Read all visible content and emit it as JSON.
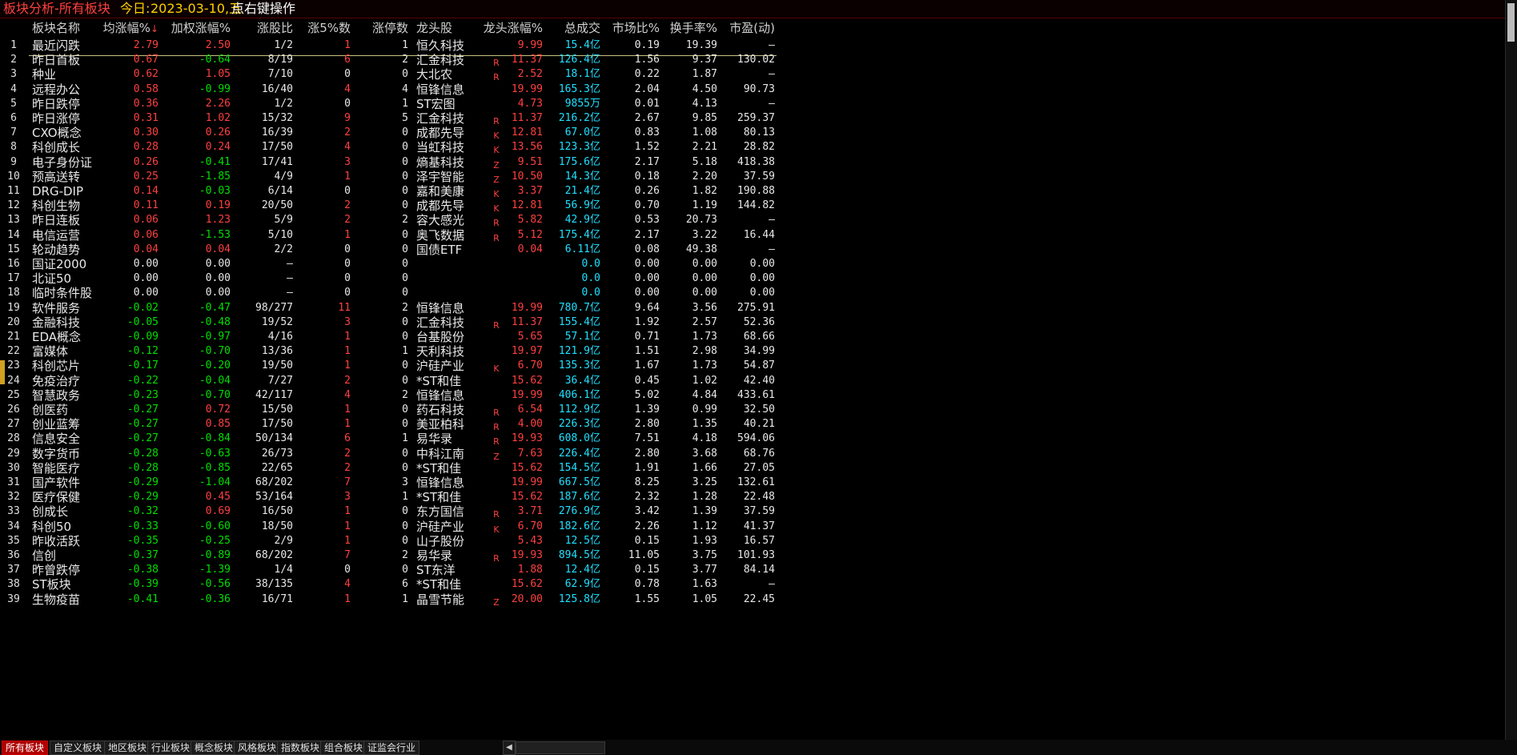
{
  "titlebar": {
    "title": "板块分析-所有板块",
    "date_label": "今日:",
    "date": "2023-03-10,五",
    "hint": "点右键操作"
  },
  "columns": {
    "name": "板块名称",
    "chg": "均涨幅%",
    "sort_indicator": "↓",
    "wchg": "加权涨幅%",
    "ratio": "涨股比",
    "up5": "涨5%数",
    "limit": "涨停数",
    "leader": "龙头股",
    "leader_chg": "龙头涨幅%",
    "amount": "总成交",
    "market": "市场比%",
    "turnover": "换手率%",
    "pe": "市盈(动)"
  },
  "colors": {
    "up": "#ff4040",
    "down": "#00e000",
    "amount": "#20e0ff",
    "accent": "#b00000"
  },
  "rows": [
    {
      "idx": "1",
      "name": "最近闪跌",
      "chg": "2.79",
      "wchg": "2.50",
      "ratio": "1/2",
      "up5": "1",
      "limit": "1",
      "leader": "恒久科技",
      "flag": "",
      "lchg": "9.99",
      "amt": "15.4亿",
      "mkt": "0.19",
      "turn": "19.39",
      "pe": "—"
    },
    {
      "idx": "2",
      "name": "昨日首板",
      "chg": "0.67",
      "wchg": "-0.64",
      "ratio": "8/19",
      "up5": "6",
      "limit": "2",
      "leader": "汇金科技",
      "flag": "R",
      "lchg": "11.37",
      "amt": "126.4亿",
      "mkt": "1.56",
      "turn": "9.37",
      "pe": "130.02"
    },
    {
      "idx": "3",
      "name": "种业",
      "chg": "0.62",
      "wchg": "1.05",
      "ratio": "7/10",
      "up5": "0",
      "limit": "0",
      "leader": "大北农",
      "flag": "R",
      "lchg": "2.52",
      "amt": "18.1亿",
      "mkt": "0.22",
      "turn": "1.87",
      "pe": "—"
    },
    {
      "idx": "4",
      "name": "远程办公",
      "chg": "0.58",
      "wchg": "-0.99",
      "ratio": "16/40",
      "up5": "4",
      "limit": "4",
      "leader": "恒锋信息",
      "flag": "",
      "lchg": "19.99",
      "amt": "165.3亿",
      "mkt": "2.04",
      "turn": "4.50",
      "pe": "90.73"
    },
    {
      "idx": "5",
      "name": "昨日跌停",
      "chg": "0.36",
      "wchg": "2.26",
      "ratio": "1/2",
      "up5": "0",
      "limit": "1",
      "leader": "ST宏图",
      "flag": "",
      "lchg": "4.73",
      "amt": "9855万",
      "mkt": "0.01",
      "turn": "4.13",
      "pe": "—"
    },
    {
      "idx": "6",
      "name": "昨日涨停",
      "chg": "0.31",
      "wchg": "1.02",
      "ratio": "15/32",
      "up5": "9",
      "limit": "5",
      "leader": "汇金科技",
      "flag": "R",
      "lchg": "11.37",
      "amt": "216.2亿",
      "mkt": "2.67",
      "turn": "9.85",
      "pe": "259.37"
    },
    {
      "idx": "7",
      "name": "CXO概念",
      "chg": "0.30",
      "wchg": "0.26",
      "ratio": "16/39",
      "up5": "2",
      "limit": "0",
      "leader": "成都先导",
      "flag": "K",
      "lchg": "12.81",
      "amt": "67.0亿",
      "mkt": "0.83",
      "turn": "1.08",
      "pe": "80.13"
    },
    {
      "idx": "8",
      "name": "科创成长",
      "chg": "0.28",
      "wchg": "0.24",
      "ratio": "17/50",
      "up5": "4",
      "limit": "0",
      "leader": "当虹科技",
      "flag": "K",
      "lchg": "13.56",
      "amt": "123.3亿",
      "mkt": "1.52",
      "turn": "2.21",
      "pe": "28.82"
    },
    {
      "idx": "9",
      "name": "电子身份证",
      "chg": "0.26",
      "wchg": "-0.41",
      "ratio": "17/41",
      "up5": "3",
      "limit": "0",
      "leader": "熵基科技",
      "flag": "Z",
      "lchg": "9.51",
      "amt": "175.6亿",
      "mkt": "2.17",
      "turn": "5.18",
      "pe": "418.38"
    },
    {
      "idx": "10",
      "name": "预高送转",
      "chg": "0.25",
      "wchg": "-1.85",
      "ratio": "4/9",
      "up5": "1",
      "limit": "0",
      "leader": "泽宇智能",
      "flag": "Z",
      "lchg": "10.50",
      "amt": "14.3亿",
      "mkt": "0.18",
      "turn": "2.20",
      "pe": "37.59"
    },
    {
      "idx": "11",
      "name": "DRG-DIP",
      "chg": "0.14",
      "wchg": "-0.03",
      "ratio": "6/14",
      "up5": "0",
      "limit": "0",
      "leader": "嘉和美康",
      "flag": "K",
      "lchg": "3.37",
      "amt": "21.4亿",
      "mkt": "0.26",
      "turn": "1.82",
      "pe": "190.88"
    },
    {
      "idx": "12",
      "name": "科创生物",
      "chg": "0.11",
      "wchg": "0.19",
      "ratio": "20/50",
      "up5": "2",
      "limit": "0",
      "leader": "成都先导",
      "flag": "K",
      "lchg": "12.81",
      "amt": "56.9亿",
      "mkt": "0.70",
      "turn": "1.19",
      "pe": "144.82"
    },
    {
      "idx": "13",
      "name": "昨日连板",
      "chg": "0.06",
      "wchg": "1.23",
      "ratio": "5/9",
      "up5": "2",
      "limit": "2",
      "leader": "容大感光",
      "flag": "R",
      "lchg": "5.82",
      "amt": "42.9亿",
      "mkt": "0.53",
      "turn": "20.73",
      "pe": "—"
    },
    {
      "idx": "14",
      "name": "电信运营",
      "chg": "0.06",
      "wchg": "-1.53",
      "ratio": "5/10",
      "up5": "1",
      "limit": "0",
      "leader": "奥飞数据",
      "flag": "R",
      "lchg": "5.12",
      "amt": "175.4亿",
      "mkt": "2.17",
      "turn": "3.22",
      "pe": "16.44"
    },
    {
      "idx": "15",
      "name": "轮动趋势",
      "chg": "0.04",
      "wchg": "0.04",
      "ratio": "2/2",
      "up5": "0",
      "limit": "0",
      "leader": "国债ETF",
      "flag": "",
      "lchg": "0.04",
      "amt": "6.11亿",
      "mkt": "0.08",
      "turn": "49.38",
      "pe": "—"
    },
    {
      "idx": "16",
      "name": "国证2000",
      "chg": "0.00",
      "wchg": "0.00",
      "ratio": "—",
      "up5": "0",
      "limit": "0",
      "leader": "",
      "flag": "",
      "lchg": "",
      "amt": "0.0",
      "mkt": "0.00",
      "turn": "0.00",
      "pe": "0.00"
    },
    {
      "idx": "17",
      "name": "北证50",
      "chg": "0.00",
      "wchg": "0.00",
      "ratio": "—",
      "up5": "0",
      "limit": "0",
      "leader": "",
      "flag": "",
      "lchg": "",
      "amt": "0.0",
      "mkt": "0.00",
      "turn": "0.00",
      "pe": "0.00"
    },
    {
      "idx": "18",
      "name": "临时条件股",
      "chg": "0.00",
      "wchg": "0.00",
      "ratio": "—",
      "up5": "0",
      "limit": "0",
      "leader": "",
      "flag": "",
      "lchg": "",
      "amt": "0.0",
      "mkt": "0.00",
      "turn": "0.00",
      "pe": "0.00"
    },
    {
      "idx": "19",
      "name": "软件服务",
      "chg": "-0.02",
      "wchg": "-0.47",
      "ratio": "98/277",
      "up5": "11",
      "limit": "2",
      "leader": "恒锋信息",
      "flag": "",
      "lchg": "19.99",
      "amt": "780.7亿",
      "mkt": "9.64",
      "turn": "3.56",
      "pe": "275.91"
    },
    {
      "idx": "20",
      "name": "金融科技",
      "chg": "-0.05",
      "wchg": "-0.48",
      "ratio": "19/52",
      "up5": "3",
      "limit": "0",
      "leader": "汇金科技",
      "flag": "R",
      "lchg": "11.37",
      "amt": "155.4亿",
      "mkt": "1.92",
      "turn": "2.57",
      "pe": "52.36"
    },
    {
      "idx": "21",
      "name": "EDA概念",
      "chg": "-0.09",
      "wchg": "-0.97",
      "ratio": "4/16",
      "up5": "1",
      "limit": "0",
      "leader": "台基股份",
      "flag": "",
      "lchg": "5.65",
      "amt": "57.1亿",
      "mkt": "0.71",
      "turn": "1.73",
      "pe": "68.66"
    },
    {
      "idx": "22",
      "name": "富媒体",
      "chg": "-0.12",
      "wchg": "-0.70",
      "ratio": "13/36",
      "up5": "1",
      "limit": "1",
      "leader": "天利科技",
      "flag": "",
      "lchg": "19.97",
      "amt": "121.9亿",
      "mkt": "1.51",
      "turn": "2.98",
      "pe": "34.99"
    },
    {
      "idx": "23",
      "name": "科创芯片",
      "chg": "-0.17",
      "wchg": "-0.20",
      "ratio": "19/50",
      "up5": "1",
      "limit": "0",
      "leader": "沪硅产业",
      "flag": "K",
      "lchg": "6.70",
      "amt": "135.3亿",
      "mkt": "1.67",
      "turn": "1.73",
      "pe": "54.87"
    },
    {
      "idx": "24",
      "name": "免疫治疗",
      "chg": "-0.22",
      "wchg": "-0.04",
      "ratio": "7/27",
      "up5": "2",
      "limit": "0",
      "leader": "*ST和佳",
      "flag": "",
      "lchg": "15.62",
      "amt": "36.4亿",
      "mkt": "0.45",
      "turn": "1.02",
      "pe": "42.40"
    },
    {
      "idx": "25",
      "name": "智慧政务",
      "chg": "-0.23",
      "wchg": "-0.70",
      "ratio": "42/117",
      "up5": "4",
      "limit": "2",
      "leader": "恒锋信息",
      "flag": "",
      "lchg": "19.99",
      "amt": "406.1亿",
      "mkt": "5.02",
      "turn": "4.84",
      "pe": "433.61"
    },
    {
      "idx": "26",
      "name": "创医药",
      "chg": "-0.27",
      "wchg": "0.72",
      "ratio": "15/50",
      "up5": "1",
      "limit": "0",
      "leader": "药石科技",
      "flag": "R",
      "lchg": "6.54",
      "amt": "112.9亿",
      "mkt": "1.39",
      "turn": "0.99",
      "pe": "32.50"
    },
    {
      "idx": "27",
      "name": "创业蓝筹",
      "chg": "-0.27",
      "wchg": "0.85",
      "ratio": "17/50",
      "up5": "1",
      "limit": "0",
      "leader": "美亚柏科",
      "flag": "R",
      "lchg": "4.00",
      "amt": "226.3亿",
      "mkt": "2.80",
      "turn": "1.35",
      "pe": "40.21"
    },
    {
      "idx": "28",
      "name": "信息安全",
      "chg": "-0.27",
      "wchg": "-0.84",
      "ratio": "50/134",
      "up5": "6",
      "limit": "1",
      "leader": "易华录",
      "flag": "R",
      "lchg": "19.93",
      "amt": "608.0亿",
      "mkt": "7.51",
      "turn": "4.18",
      "pe": "594.06"
    },
    {
      "idx": "29",
      "name": "数字货币",
      "chg": "-0.28",
      "wchg": "-0.63",
      "ratio": "26/73",
      "up5": "2",
      "limit": "0",
      "leader": "中科江南",
      "flag": "Z",
      "lchg": "7.63",
      "amt": "226.4亿",
      "mkt": "2.80",
      "turn": "3.68",
      "pe": "68.76"
    },
    {
      "idx": "30",
      "name": "智能医疗",
      "chg": "-0.28",
      "wchg": "-0.85",
      "ratio": "22/65",
      "up5": "2",
      "limit": "0",
      "leader": "*ST和佳",
      "flag": "",
      "lchg": "15.62",
      "amt": "154.5亿",
      "mkt": "1.91",
      "turn": "1.66",
      "pe": "27.05"
    },
    {
      "idx": "31",
      "name": "国产软件",
      "chg": "-0.29",
      "wchg": "-1.04",
      "ratio": "68/202",
      "up5": "7",
      "limit": "3",
      "leader": "恒锋信息",
      "flag": "",
      "lchg": "19.99",
      "amt": "667.5亿",
      "mkt": "8.25",
      "turn": "3.25",
      "pe": "132.61"
    },
    {
      "idx": "32",
      "name": "医疗保健",
      "chg": "-0.29",
      "wchg": "0.45",
      "ratio": "53/164",
      "up5": "3",
      "limit": "1",
      "leader": "*ST和佳",
      "flag": "",
      "lchg": "15.62",
      "amt": "187.6亿",
      "mkt": "2.32",
      "turn": "1.28",
      "pe": "22.48"
    },
    {
      "idx": "33",
      "name": "创成长",
      "chg": "-0.32",
      "wchg": "0.69",
      "ratio": "16/50",
      "up5": "1",
      "limit": "0",
      "leader": "东方国信",
      "flag": "R",
      "lchg": "3.71",
      "amt": "276.9亿",
      "mkt": "3.42",
      "turn": "1.39",
      "pe": "37.59"
    },
    {
      "idx": "34",
      "name": "科创50",
      "chg": "-0.33",
      "wchg": "-0.60",
      "ratio": "18/50",
      "up5": "1",
      "limit": "0",
      "leader": "沪硅产业",
      "flag": "K",
      "lchg": "6.70",
      "amt": "182.6亿",
      "mkt": "2.26",
      "turn": "1.12",
      "pe": "41.37"
    },
    {
      "idx": "35",
      "name": "昨收活跃",
      "chg": "-0.35",
      "wchg": "-0.25",
      "ratio": "2/9",
      "up5": "1",
      "limit": "0",
      "leader": "山子股份",
      "flag": "",
      "lchg": "5.43",
      "amt": "12.5亿",
      "mkt": "0.15",
      "turn": "1.93",
      "pe": "16.57"
    },
    {
      "idx": "36",
      "name": "信创",
      "chg": "-0.37",
      "wchg": "-0.89",
      "ratio": "68/202",
      "up5": "7",
      "limit": "2",
      "leader": "易华录",
      "flag": "R",
      "lchg": "19.93",
      "amt": "894.5亿",
      "mkt": "11.05",
      "turn": "3.75",
      "pe": "101.93"
    },
    {
      "idx": "37",
      "name": "昨曾跌停",
      "chg": "-0.38",
      "wchg": "-1.39",
      "ratio": "1/4",
      "up5": "0",
      "limit": "0",
      "leader": "ST东洋",
      "flag": "",
      "lchg": "1.88",
      "amt": "12.4亿",
      "mkt": "0.15",
      "turn": "3.77",
      "pe": "84.14"
    },
    {
      "idx": "38",
      "name": "ST板块",
      "chg": "-0.39",
      "wchg": "-0.56",
      "ratio": "38/135",
      "up5": "4",
      "limit": "6",
      "leader": "*ST和佳",
      "flag": "",
      "lchg": "15.62",
      "amt": "62.9亿",
      "mkt": "0.78",
      "turn": "1.63",
      "pe": "—"
    },
    {
      "idx": "39",
      "name": "生物疫苗",
      "chg": "-0.41",
      "wchg": "-0.36",
      "ratio": "16/71",
      "up5": "1",
      "limit": "1",
      "leader": "晶雪节能",
      "flag": "Z",
      "lchg": "20.00",
      "amt": "125.8亿",
      "mkt": "1.55",
      "turn": "1.05",
      "pe": "22.45"
    }
  ],
  "tabs": [
    {
      "label": "所有板块",
      "active": true
    },
    {
      "label": "自定义板块",
      "active": false
    },
    {
      "label": "地区板块",
      "active": false
    },
    {
      "label": "行业板块",
      "active": false
    },
    {
      "label": "概念板块",
      "active": false
    },
    {
      "label": "风格板块",
      "active": false
    },
    {
      "label": "指数板块",
      "active": false
    },
    {
      "label": "组合板块",
      "active": false
    },
    {
      "label": "证监会行业",
      "active": false
    }
  ],
  "tab_scroll_icon": "left-arrow-icon",
  "tab_scroll_glyph": "◀"
}
